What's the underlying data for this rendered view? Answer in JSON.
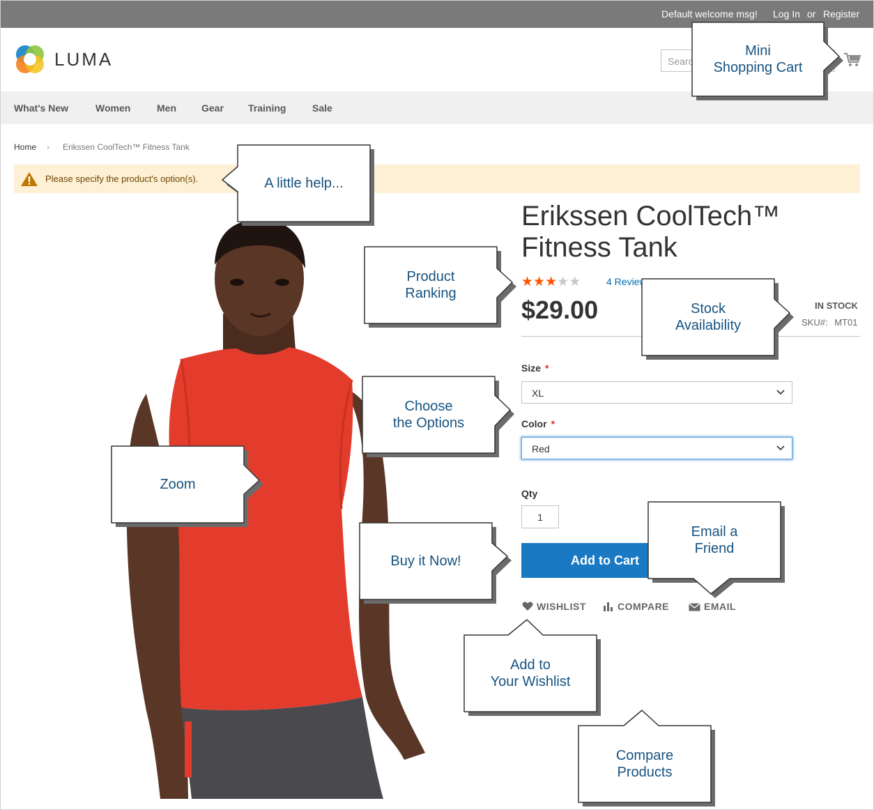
{
  "top_bar": {
    "welcome": "Default welcome msg!",
    "login": "Log In",
    "or": "or",
    "register": "Register"
  },
  "header": {
    "logo_text": "LUMA",
    "search_placeholder": "Search",
    "cart_icon": "cart-icon"
  },
  "nav": {
    "items": [
      "What's New",
      "Women",
      "Men",
      "Gear",
      "Training",
      "Sale"
    ]
  },
  "breadcrumb": {
    "home": "Home",
    "separator": "›",
    "current": "Erikssen CoolTech™ Fitness Tank"
  },
  "notice": {
    "message": "Please specify the product's option(s).",
    "icon": "warning-icon"
  },
  "product": {
    "title_line1": "Erikssen CoolTech™",
    "title_line2": "Fitness Tank",
    "rating": 3,
    "rating_max": 5,
    "reviews": "4 Review",
    "price": "$29.00",
    "stock": "IN STOCK",
    "sku_label": "SKU#:",
    "sku": "MT01",
    "size_label": "Size",
    "size_value": "XL",
    "color_label": "Color",
    "color_value": "Red",
    "required_mark": "*",
    "qty_label": "Qty",
    "qty_value": "1",
    "add_to_cart": "Add to Cart",
    "wishlist": "WISHLIST",
    "compare": "COMPARE",
    "email": "EMAIL"
  },
  "callouts": {
    "mini_cart_1": "Mini",
    "mini_cart_2": "Shopping Cart",
    "little_help": "A little help...",
    "ranking_1": "Product",
    "ranking_2": "Ranking",
    "stock_1": "Stock",
    "stock_2": "Availability",
    "options_1": "Choose",
    "options_2": "the Options",
    "zoom": "Zoom",
    "buy_now": "Buy it Now!",
    "email_1": "Email a",
    "email_2": "Friend",
    "wishlist_1": "Add to",
    "wishlist_2": "Your Wishlist",
    "compare_1": "Compare",
    "compare_2": "Products"
  },
  "colors": {
    "accent": "#1979c3",
    "star": "#ff5501",
    "notice_bg": "#fdf0d5",
    "callout_text": "#17527f",
    "shirt": "#e43c2c"
  }
}
